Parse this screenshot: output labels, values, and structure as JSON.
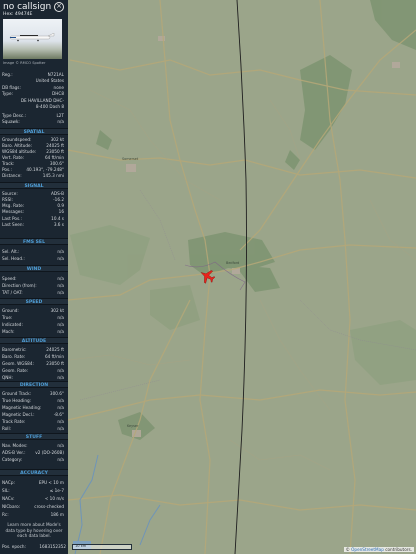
{
  "header": {
    "callsign": "no callsign",
    "hex": "Hex: 49474E",
    "photo_credit": "Image © RMCO Spotter"
  },
  "details": [
    {
      "label": "Reg.:",
      "value": "N721AL"
    },
    {
      "label": "",
      "value": "United States"
    },
    {
      "label": "DB flags:",
      "value": "none"
    },
    {
      "label": "Type:",
      "value": "DHC8"
    },
    {
      "label": "",
      "value": "DE HAVILLAND DHC-8-400 Dash 8"
    },
    {
      "label": "Type Desc.:",
      "value": "L2T"
    },
    {
      "label": "Squawk:",
      "value": "n/a"
    }
  ],
  "sections": {
    "spatial": "SPATIAL",
    "signal": "SIGNAL",
    "fms": "FMS SEL",
    "wind": "WIND",
    "speed": "SPEED",
    "altitude": "ALTITUDE",
    "direction": "DIRECTION",
    "stuff": "STUFF",
    "accuracy": "ACCURACY"
  },
  "spatial": [
    {
      "label": "Groundspeed:",
      "value": "302 kt"
    },
    {
      "label": "Baro. Altitude:",
      "value": "24025 ft"
    },
    {
      "label": "WGS84 altitude:",
      "value": "23050 ft"
    },
    {
      "label": "Vert. Rate:",
      "value": "64 ft/min"
    },
    {
      "label": "Track:",
      "value": "300.6°"
    },
    {
      "label": "Pos.:",
      "value": "40.193°, -79.248°"
    },
    {
      "label": "Distance:",
      "value": "145.3 nmi"
    }
  ],
  "signal": [
    {
      "label": "Source:",
      "value": "ADS-B"
    },
    {
      "label": "RSSI:",
      "value": "-16.2"
    },
    {
      "label": "Msg. Rate:",
      "value": "0.9"
    },
    {
      "label": "Messages:",
      "value": "16"
    },
    {
      "label": "Last Pos.:",
      "value": "10.4 s"
    },
    {
      "label": "Last Seen:",
      "value": "3.6 s"
    }
  ],
  "fms": [
    {
      "label": "Sel. Alt.:",
      "value": "n/a"
    },
    {
      "label": "Sel. Head.:",
      "value": "n/a"
    }
  ],
  "wind": [
    {
      "label": "Speed:",
      "value": "n/a"
    },
    {
      "label": "Direction (from):",
      "value": "n/a"
    },
    {
      "label": "TAT / OAT:",
      "value": "n/a"
    }
  ],
  "speed": [
    {
      "label": "Ground:",
      "value": "302 kt"
    },
    {
      "label": "True:",
      "value": "n/a"
    },
    {
      "label": "Indicated:",
      "value": "n/a"
    },
    {
      "label": "Mach:",
      "value": "n/a"
    }
  ],
  "altitude": [
    {
      "label": "Barometric:",
      "value": "24025 ft"
    },
    {
      "label": "Baro. Rate:",
      "value": "64 ft/min"
    },
    {
      "label": "Geom. WGS84:",
      "value": "23050 ft"
    },
    {
      "label": "Geom. Rate:",
      "value": "n/a"
    },
    {
      "label": "QNH:",
      "value": "n/a"
    }
  ],
  "direction": [
    {
      "label": "Ground Track:",
      "value": "300.6°"
    },
    {
      "label": "True Heading:",
      "value": "n/a"
    },
    {
      "label": "Magnetic Heading:",
      "value": "n/a"
    },
    {
      "label": "Magnetic Decl.:",
      "value": "-8.6°"
    },
    {
      "label": "Track Rate:",
      "value": "n/a"
    },
    {
      "label": "Roll:",
      "value": "n/a"
    }
  ],
  "stuff": [
    {
      "label": "Nav. Modes:",
      "value": "n/a"
    },
    {
      "label": "ADS-B Ver.:",
      "value": "v2 (DO-260B)"
    },
    {
      "label": "Category:",
      "value": "n/a"
    }
  ],
  "accuracy": [
    {
      "label": "NACp:",
      "value": "EPU < 10 m"
    },
    {
      "label": "SIL:",
      "value": "≤ 1e-7"
    },
    {
      "label": "NACv:",
      "value": "< 10 m/s"
    },
    {
      "label": "NICbaro:",
      "value": "cross-checked"
    },
    {
      "label": "Rc:",
      "value": "186 m"
    }
  ],
  "footer": {
    "learn_more": "Learn more about Mode's data type by hovering over each data label.",
    "epoch_label": "Pos. epoch:",
    "epoch_value": "1683152352"
  },
  "map": {
    "attribution_prefix": "© ",
    "attribution_link": "OpenStreetMap",
    "attribution_suffix": " contributors.",
    "aircraft_color": "#e8231c",
    "path_color": "#1f1f1f"
  }
}
